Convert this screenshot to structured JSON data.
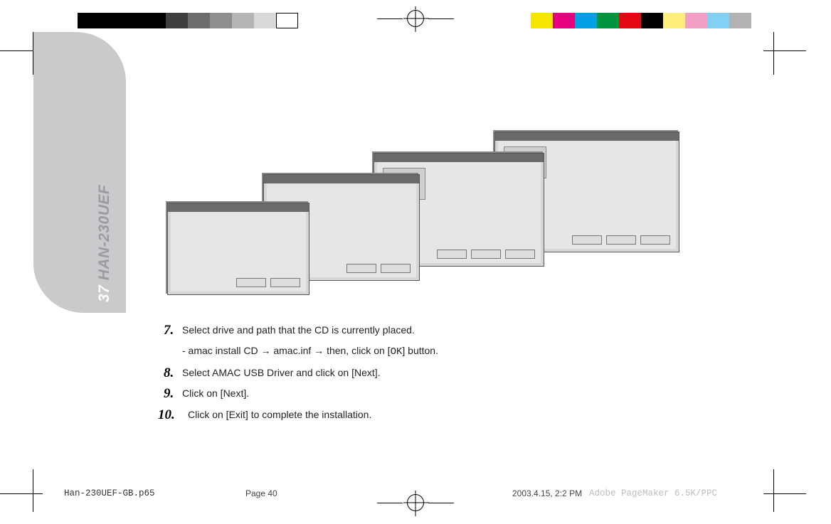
{
  "colorbars": {
    "left": [
      "#000000",
      "#000000",
      "#000000",
      "#000000",
      "#3f3f3f",
      "#6c6c6c",
      "#8e8e8e",
      "#b5b5b5",
      "#d9d9d9",
      "#ffffff"
    ],
    "right": [
      "#f6e500",
      "#e6007e",
      "#00a0e3",
      "#009640",
      "#e30613",
      "#000000",
      "#fff07c",
      "#f29ec4",
      "#83d0f5",
      "#b2b2b2"
    ]
  },
  "tab": {
    "page_num": "37",
    "model": "HAN-230UEF"
  },
  "steps": {
    "s7": {
      "n": "7.",
      "text": "Select drive and path that the CD is currently placed."
    },
    "s7sub_a": "- amac install CD ",
    "s7sub_b": " amac.inf ",
    "s7sub_c": " then, click on [",
    "s7sub_ok": "OK",
    "s7sub_d": "] button.",
    "arrow": "→",
    "s8": {
      "n": "8.",
      "text": "Select AMAC USB Driver and click on [Next]."
    },
    "s9": {
      "n": "9.",
      "text": "Click on [Next]."
    },
    "s10": {
      "n": "10.",
      "text": "Click on [Exit] to complete the installation."
    }
  },
  "footer": {
    "file": "Han-230UEF-GB.p65",
    "page": "Page 40",
    "date": "2003.4.15, 2:2 PM",
    "app": "Adobe PageMaker 6.5K/PPC"
  }
}
